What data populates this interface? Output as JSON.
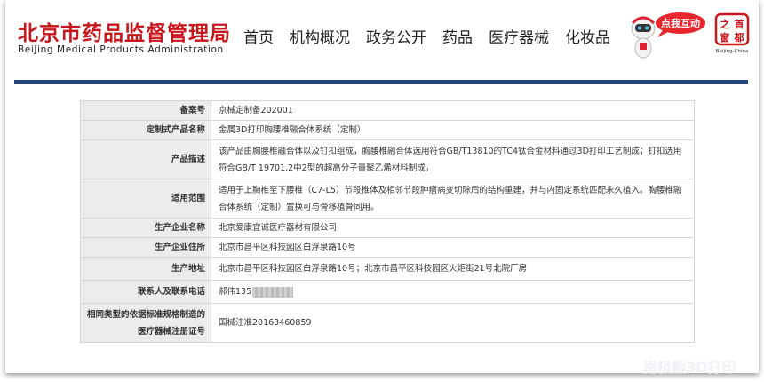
{
  "header": {
    "org_name_cn": "北京市药品监督管理局",
    "org_name_en": "BeiJing Medical Products Administration",
    "nav": [
      "首页",
      "机构概况",
      "政务公开",
      "药品",
      "医疗器械",
      "化妆品"
    ],
    "interact_badge": "点我互动",
    "seal_chars": [
      "之",
      "首",
      "窗",
      "都"
    ],
    "seal_caption": "Beijing-China"
  },
  "record": {
    "rows": [
      {
        "label": "备案号",
        "value": "京械定制备202001"
      },
      {
        "label": "定制式产品名称",
        "value": "金属3D打印胸腰椎融合体系统（定制）"
      },
      {
        "label": "产品描述",
        "value": "该产品由胸腰椎融合体以及钉扣组成，胸腰椎融合体选用符合GB/T13810的TC4钛合金材料通过3D打印工艺制成；钉扣选用符合GB/T 19701.2中2型的超高分子量聚乙烯材料制成。"
      },
      {
        "label": "适用范围",
        "value": "适用于上胸椎至下腰椎（C7-L5）节段椎体及相邻节段肿瘤病变切除后的结构重建，并与内固定系统匹配永久植入。胸腰椎融合体系统（定制）置换可与骨移植骨同用。"
      },
      {
        "label": "生产企业名称",
        "value": "北京爱康宜诚医疗器材有限公司"
      },
      {
        "label": "生产企业住所",
        "value": "北京市昌平区科技园区白浮泉路10号"
      },
      {
        "label": "生产地址",
        "value": "北京市昌平区科技园区白浮泉路10号；北京市昌平区科技园区火炬街21号北院厂房"
      },
      {
        "label": "联系人及联系电话",
        "value": "郝伟135"
      },
      {
        "label": "相同类型的依据标准规格制造的医疗器械注册证号",
        "value": "国械注准20163460859"
      }
    ]
  },
  "watermark": "南极熊3D打印",
  "colors": {
    "brand_red": "#c8161d",
    "rule_blue": "#24467e",
    "label_bg": "#ececec"
  }
}
